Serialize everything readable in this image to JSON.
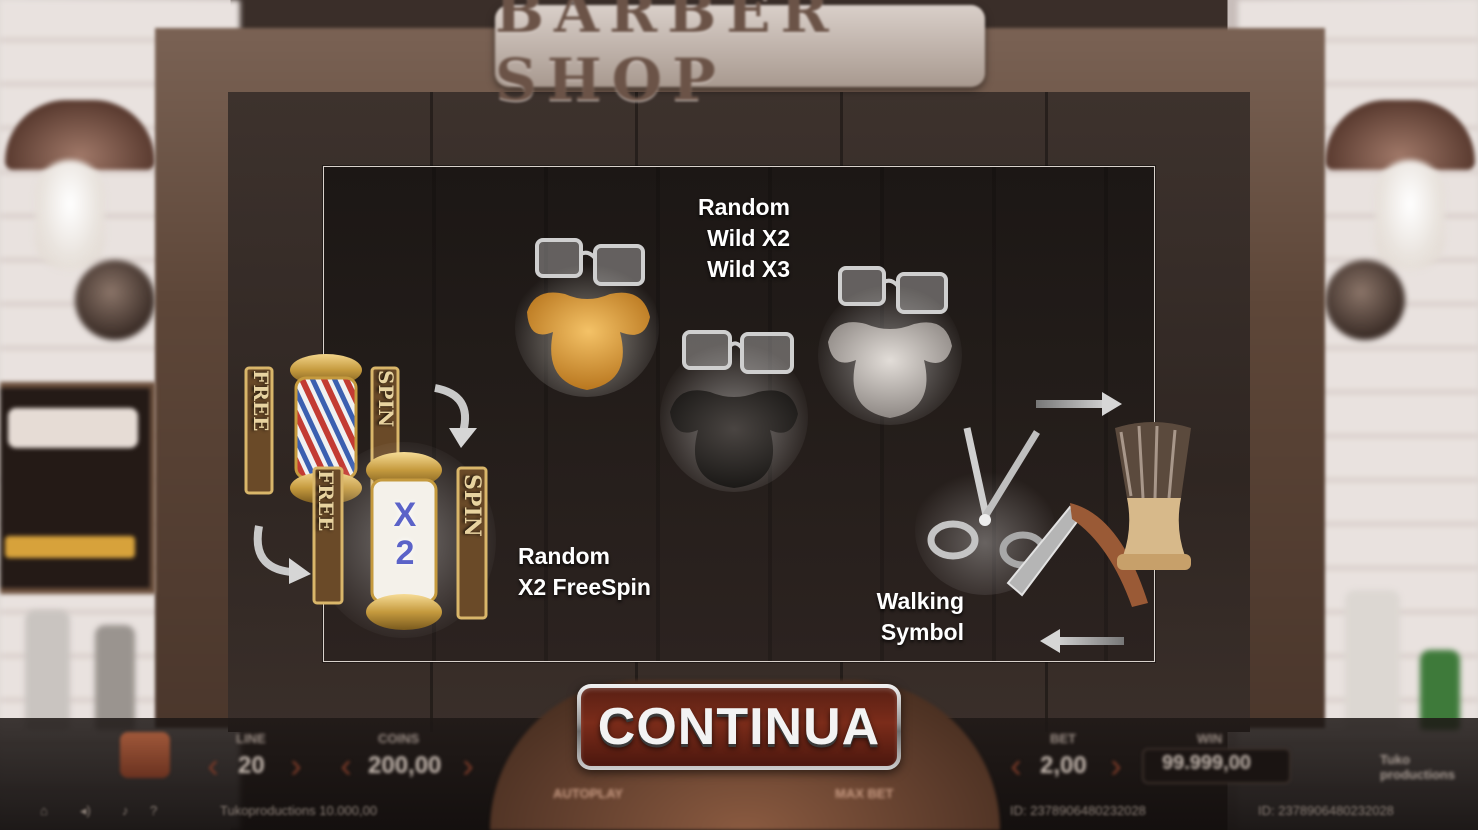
{
  "title_sign": "BARBER SHOP",
  "info_panel": {
    "wild_text": [
      "Random",
      "Wild X2",
      "Wild X3"
    ],
    "freespin_text": [
      "Random",
      "X2 FreeSpin"
    ],
    "walking_text": [
      "Walking",
      "Symbol"
    ],
    "pole_left_text_1": "FREE",
    "pole_right_text_1": "SPIN",
    "pole_left_text_2": "FREE",
    "pole_right_text_2": "SPIN",
    "multiplier": "X2"
  },
  "continue_button": {
    "label": "CONTINUA"
  },
  "controls": {
    "line_label": "LINE",
    "line_value": "20",
    "coins_label": "COINS",
    "coins_value": "200,00",
    "bet_label": "BET",
    "bet_value": "2,00",
    "win_label": "WIN",
    "win_value": "99.999,00",
    "autoplay_label": "AUTOPLAY",
    "maxbet_label": "MAX BET",
    "provider": "Tuko productions",
    "footer_balance": "Tukoproductions 10.000,00",
    "footer_id_1": "ID: 2378906480232028",
    "footer_id_2": "ID: 2378906480232028"
  },
  "colors": {
    "button_red": "#7b2c1a",
    "panel_border": "#d9d2cc",
    "beard_blonde": "#e0a23a",
    "beard_dark": "#2d2a28",
    "beard_grey": "#bdb8b3",
    "pole_gold": "#c59a3e"
  }
}
